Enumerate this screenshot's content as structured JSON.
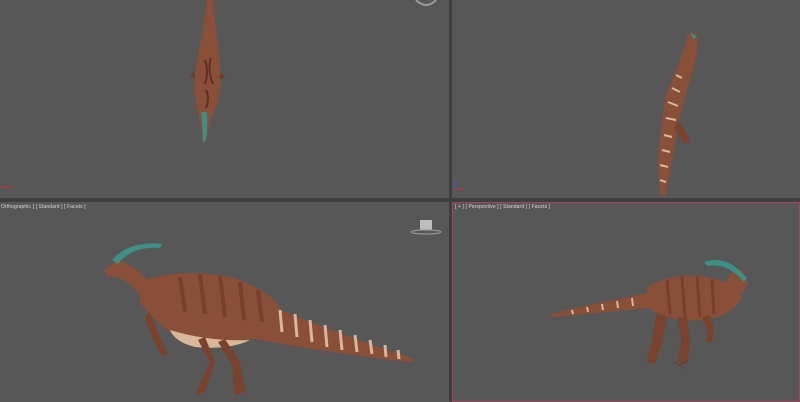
{
  "viewports": {
    "top_left": {
      "label": ""
    },
    "top_right": {
      "label": ""
    },
    "bottom_left": {
      "label": "Orthographic ] [ Standard ] [ Facets ]"
    },
    "bottom_right": {
      "label": "[ + ] [ Perspective ] [ Standard ] [ Facets ]"
    }
  },
  "colors": {
    "viewport_bg": "#575757",
    "frame_bg": "#3f3f3f",
    "active_border": "#9a4a5c",
    "skin": "#8a4f38",
    "stripe": "#d9b79a",
    "crest": "#3e8f86",
    "axis_x": "#c83232",
    "axis_y": "#3aa83a",
    "axis_z": "#3a5ac8"
  },
  "icons": {
    "viewcube_top": "viewcube-icon",
    "viewcube_left": "viewcube-icon",
    "axis_top": "axis-tripod-icon",
    "axis_front": "axis-tripod-icon"
  }
}
